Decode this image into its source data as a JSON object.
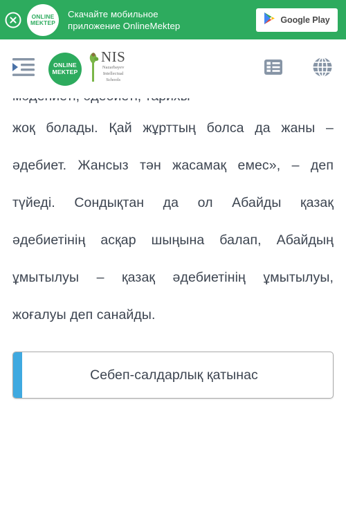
{
  "promo_banner": {
    "close_icon": "close-circle-icon",
    "logo_line1": "ONLINE",
    "logo_line2": "MEKTEP",
    "text_line1": "Скачайте мобильное",
    "text_line2": "приложение OnlineMektep",
    "store_button_label": "Google Play",
    "store_icon": "google-play-icon",
    "background_color": "#2dab5e"
  },
  "toolbar": {
    "menu_icon": "indent-list-icon",
    "brand": {
      "online_mektep_line1": "ONLINE",
      "online_mektep_line2": "MEKTEP",
      "nis_main": "NIS",
      "nis_sub_line1": "Nazarbayev",
      "nis_sub_line2": "Intellectual",
      "nis_sub_line3": "Schools"
    },
    "list_icon": "list-view-icon",
    "globe_icon": "globe-language-icon",
    "icon_color": "#8795a6"
  },
  "content": {
    "clipped_top_line": "мәдениеті, әдебиеті, тарихы",
    "question_text": "жоқ болады. Қай жұрттың болса да жаны – әдебиет. Жансыз тән жасамақ емес», – деп түйеді. Сондықтан да ол Абайды қазақ әдебиетінің асқар шыңына балап, Абайдың ұмытылуы – қазақ әдебиетінің ұмытылуы, жоғалуы деп санайды.",
    "text_color": "#3c4450"
  },
  "answer": {
    "label": "Себеп-салдарлық қатынас",
    "accent_color": "#3fa9e0",
    "border_color": "#a9a9a9"
  }
}
